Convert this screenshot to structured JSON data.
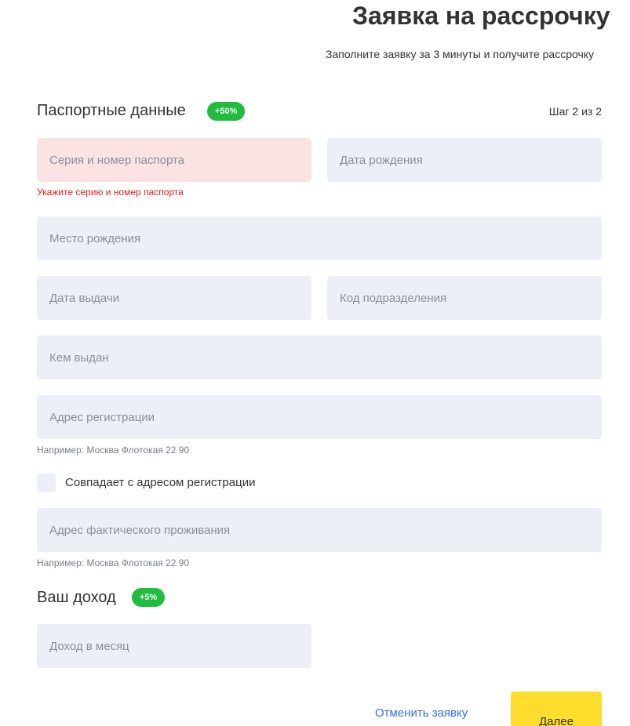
{
  "header": {
    "title": "Заявка на рассрочку",
    "subtitle": "Заполните заявку за 3 минуты и получите рассрочку"
  },
  "passport": {
    "section_title": "Паспортные данные",
    "badge": "+50%",
    "step": "Шаг 2 из 2",
    "series_number": {
      "placeholder": "Серия и номер паспорта",
      "value": "",
      "error": "Укажите серию и номер паспорта"
    },
    "birth_date": {
      "placeholder": "Дата рождения",
      "value": ""
    },
    "birth_place": {
      "placeholder": "Место рождения",
      "value": ""
    },
    "issue_date": {
      "placeholder": "Дата выдачи",
      "value": ""
    },
    "division_code": {
      "placeholder": "Код подразделения",
      "value": ""
    },
    "issued_by": {
      "placeholder": "Кем выдан",
      "value": ""
    },
    "registration_address": {
      "placeholder": "Адрес регистрации",
      "value": "",
      "hint": "Например: Москва Флотокая 22 90"
    },
    "same_address": {
      "label": "Совпадает с адресом регистрации",
      "checked": false
    },
    "actual_address": {
      "placeholder": "Адрес фактического проживания",
      "value": "",
      "hint": "Например: Москва Флотокая 22 90"
    }
  },
  "income": {
    "section_title": "Ваш доход",
    "badge": "+5%",
    "monthly_income": {
      "placeholder": "Доход в месяц",
      "value": ""
    }
  },
  "actions": {
    "cancel_label": "Отменить заявку",
    "next_label": "Далее"
  },
  "colors": {
    "field_bg": "#eceff5",
    "error_bg": "#fbe3e3",
    "error_text": "#dd2222",
    "badge_green": "#1fbc3d",
    "link_blue": "#336fee",
    "button_yellow": "#ffdd2d"
  }
}
